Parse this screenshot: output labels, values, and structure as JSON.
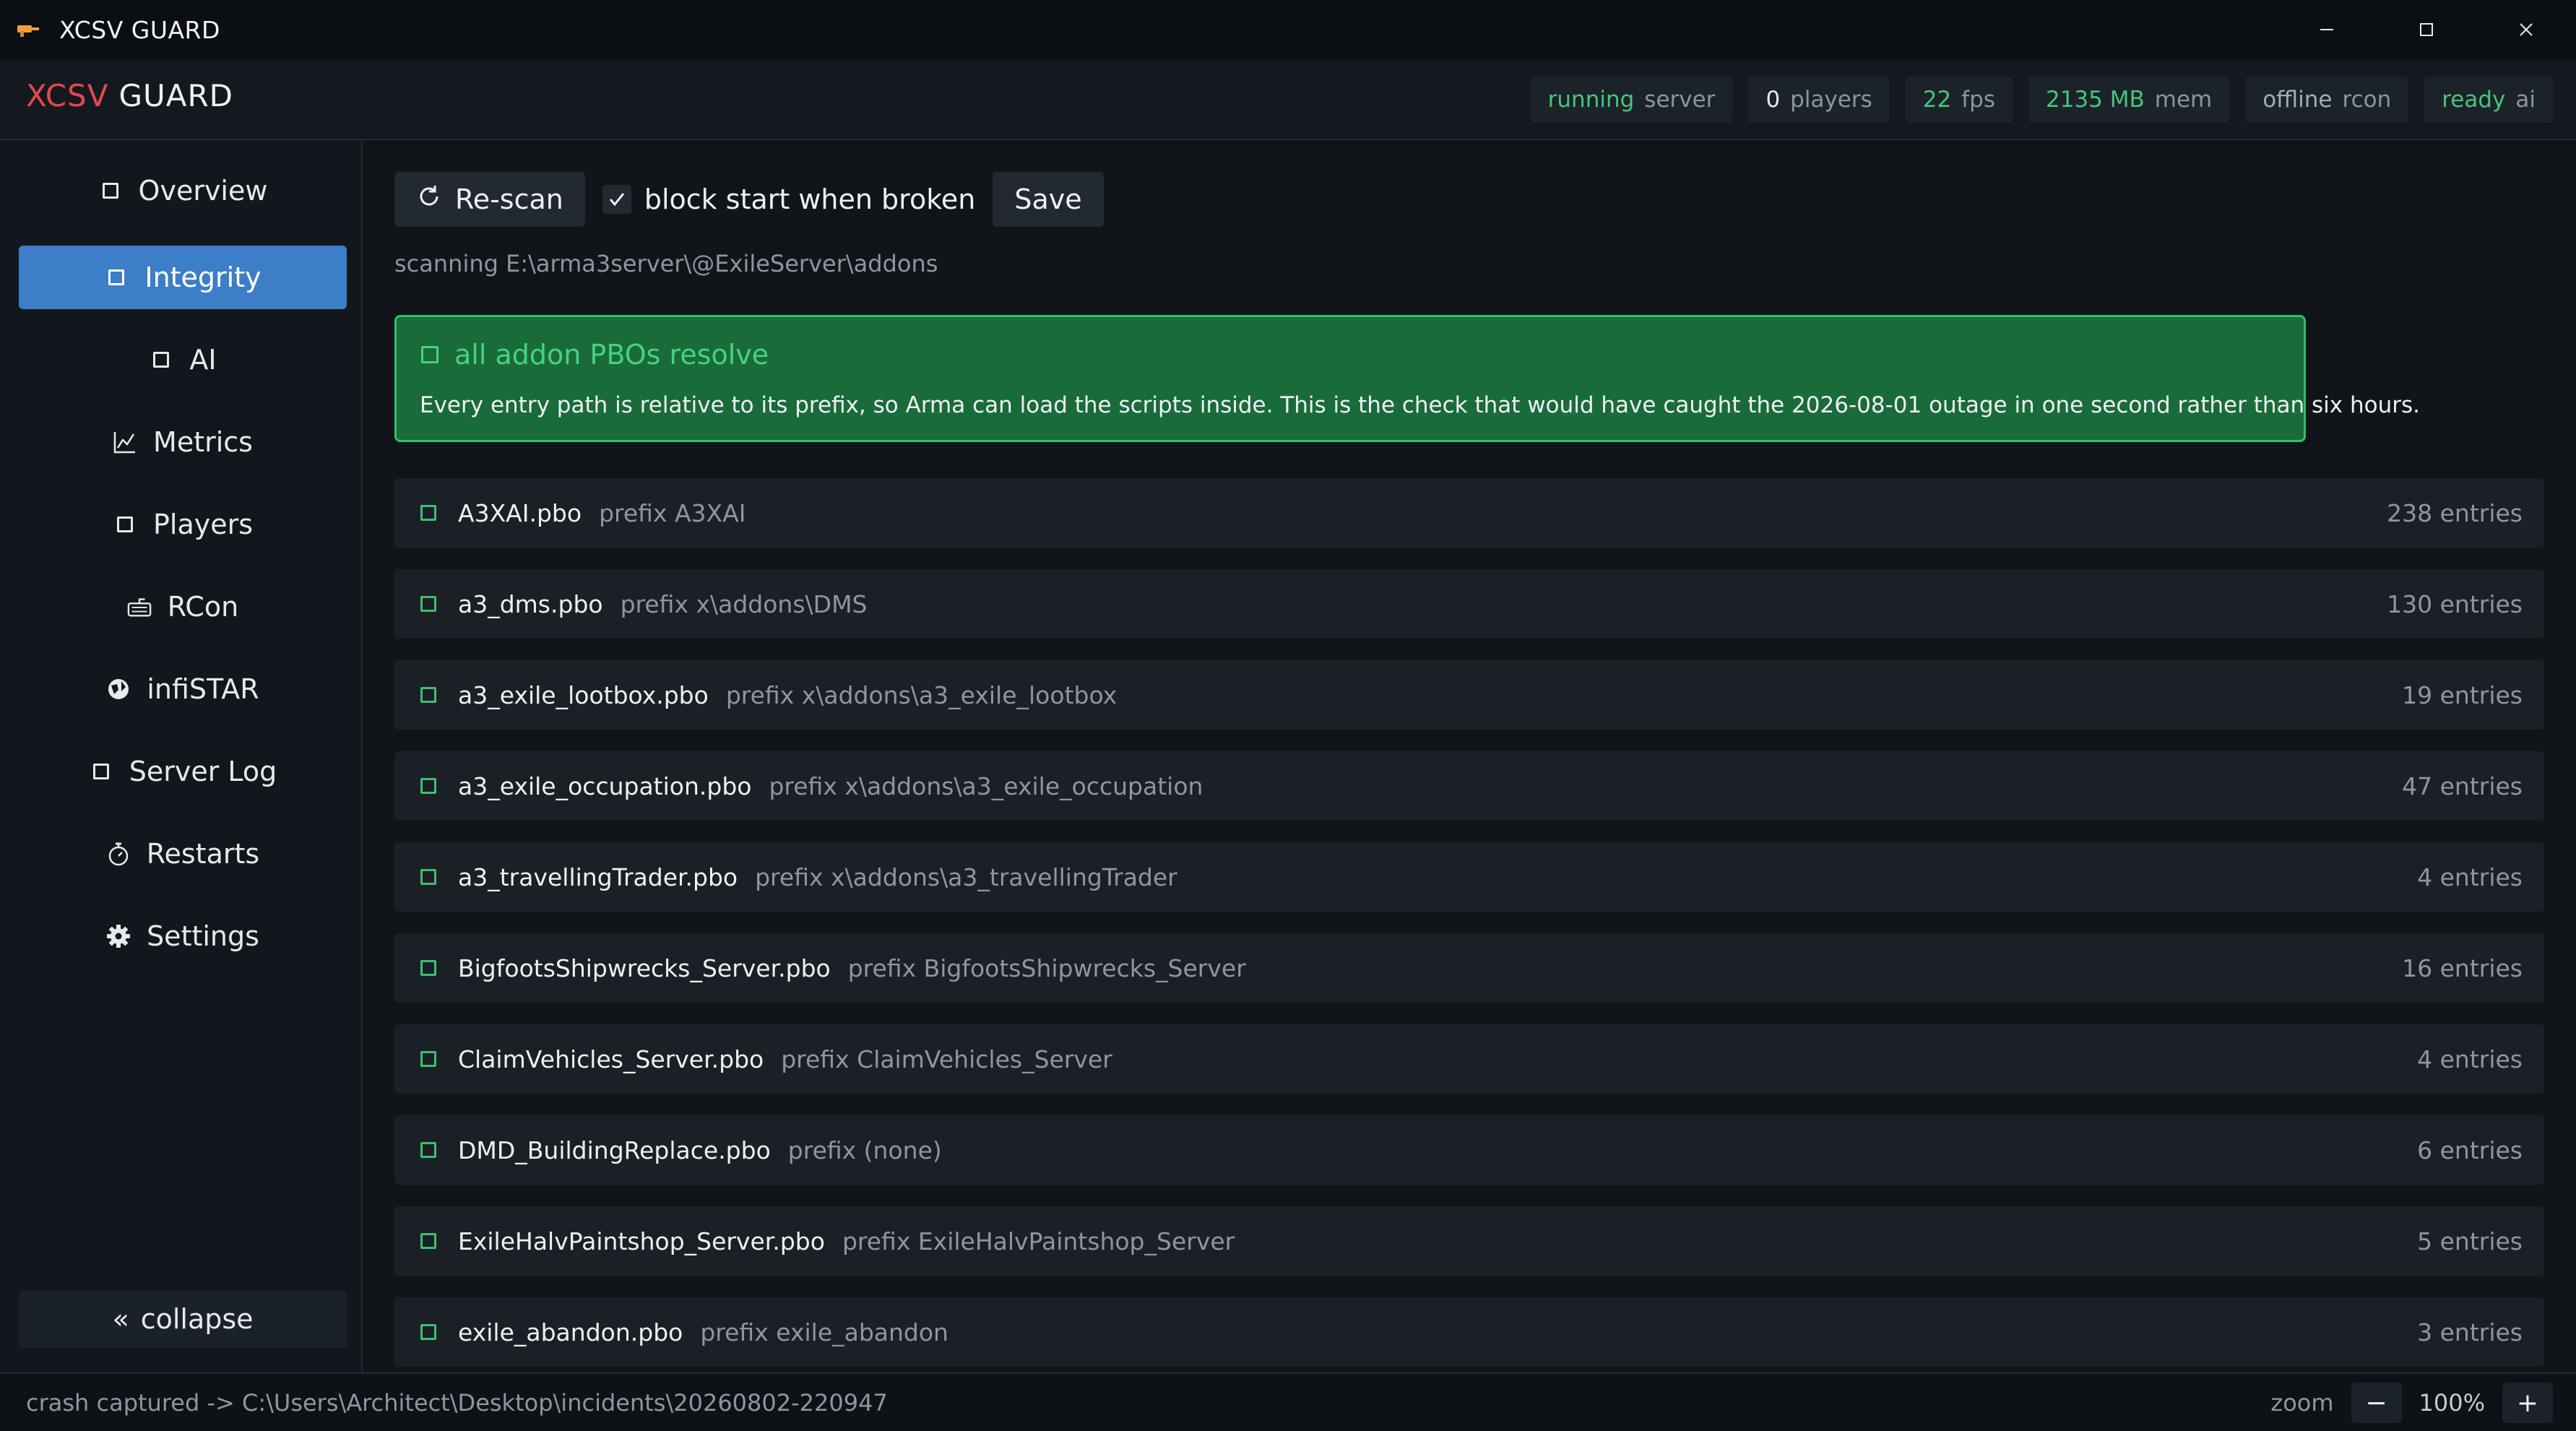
{
  "window": {
    "title": "XCSV GUARD",
    "controls": [
      "minimize",
      "maximize",
      "close"
    ]
  },
  "header": {
    "brand_part1": "XCSV",
    "brand_part2": "GUARD",
    "stats": [
      {
        "value": "running",
        "label": "server",
        "value_color": "#46c67a"
      },
      {
        "value": "0",
        "label": "players",
        "value_color": "#e6e9ed"
      },
      {
        "value": "22",
        "label": "fps",
        "value_color": "#46c67a"
      },
      {
        "value": "2135 MB",
        "label": "mem",
        "value_color": "#46c67a"
      },
      {
        "value": "offline",
        "label": "rcon",
        "value_color": "#a4abb4"
      },
      {
        "value": "ready",
        "label": "ai",
        "value_color": "#46c67a"
      }
    ]
  },
  "sidebar": {
    "items": [
      {
        "label": "Overview",
        "icon": "square-icon",
        "active": false
      },
      {
        "label": "Integrity",
        "icon": "square-icon",
        "active": true
      },
      {
        "label": "AI",
        "icon": "square-icon",
        "active": false
      },
      {
        "label": "Metrics",
        "icon": "chart-line-icon",
        "active": false
      },
      {
        "label": "Players",
        "icon": "square-icon",
        "active": false
      },
      {
        "label": "RCon",
        "icon": "keyboard-icon",
        "active": false
      },
      {
        "label": "infiSTAR",
        "icon": "shield-icon",
        "active": false
      },
      {
        "label": "Server Log",
        "icon": "square-icon",
        "active": false
      },
      {
        "label": "Restarts",
        "icon": "stopwatch-icon",
        "active": false
      },
      {
        "label": "Settings",
        "icon": "gear-icon",
        "active": false
      }
    ],
    "collapse_glyph": "«",
    "collapse_label": "collapse"
  },
  "toolbar": {
    "rescan_label": "Re-scan",
    "block_label": "block start when broken",
    "block_checked": true,
    "save_label": "Save"
  },
  "scan_path": "scanning E:\\arma3server\\@ExileServer\\addons",
  "status_box": {
    "title": "all addon PBOs resolve",
    "body": "Every entry path is relative to its prefix, so Arma can load the scripts inside. This is the check that would have caught the 2026-08-01 outage in one second rather than six hours.",
    "accent": "#2fc266"
  },
  "pbos": [
    {
      "name": "A3XAI.pbo",
      "prefix": "prefix A3XAI",
      "entries": "238 entries"
    },
    {
      "name": "a3_dms.pbo",
      "prefix": "prefix x\\addons\\DMS",
      "entries": "130 entries"
    },
    {
      "name": "a3_exile_lootbox.pbo",
      "prefix": "prefix x\\addons\\a3_exile_lootbox",
      "entries": "19 entries"
    },
    {
      "name": "a3_exile_occupation.pbo",
      "prefix": "prefix x\\addons\\a3_exile_occupation",
      "entries": "47 entries"
    },
    {
      "name": "a3_travellingTrader.pbo",
      "prefix": "prefix x\\addons\\a3_travellingTrader",
      "entries": "4 entries"
    },
    {
      "name": "BigfootsShipwrecks_Server.pbo",
      "prefix": "prefix BigfootsShipwrecks_Server",
      "entries": "16 entries"
    },
    {
      "name": "ClaimVehicles_Server.pbo",
      "prefix": "prefix ClaimVehicles_Server",
      "entries": "4 entries"
    },
    {
      "name": "DMD_BuildingReplace.pbo",
      "prefix": "prefix (none)",
      "entries": "6 entries"
    },
    {
      "name": "ExileHalvPaintshop_Server.pbo",
      "prefix": "prefix ExileHalvPaintshop_Server",
      "entries": "5 entries"
    },
    {
      "name": "exile_abandon.pbo",
      "prefix": "prefix exile_abandon",
      "entries": "3 entries"
    }
  ],
  "statusbar": {
    "crash_text": "crash captured -> C:\\Users\\Architect\\Desktop\\incidents\\20260802-220947",
    "zoom_label": "zoom",
    "zoom_minus": "−",
    "zoom_value": "100%",
    "zoom_plus": "+"
  }
}
